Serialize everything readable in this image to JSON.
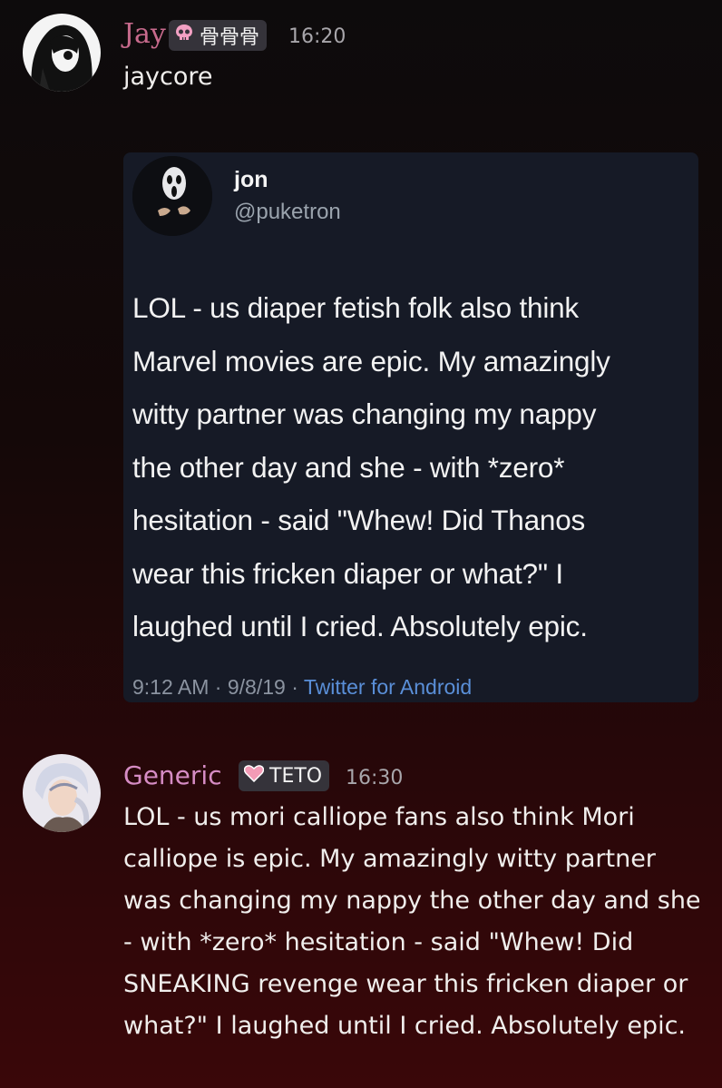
{
  "messages": [
    {
      "username": "Jay",
      "username_color": "#c76a8c",
      "tag_icon": "skull-icon",
      "tag_text": "骨骨骨",
      "time": "16:20",
      "text": "jaycore"
    },
    {
      "username": "Generic",
      "username_color": "#d68cc4",
      "tag_icon": "pink-heart-icon",
      "tag_text": "TETO",
      "time": "16:30",
      "text": "LOL - us mori calliope fans also think Mori calliope is epic. My amazingly witty partner was changing my nappy the other day and she - with *zero* hesitation - said \"Whew! Did SNEAKING revenge wear this fricken diaper or what?\" I laughed until I cried. Absolutely epic."
    }
  ],
  "tweet": {
    "name": "jon",
    "handle": "@puketron",
    "lines": [
      "LOL - us diaper fetish folk also think",
      "Marvel movies are epic. My amazingly",
      "witty partner was changing my nappy",
      "the other day and she - with *zero*",
      "hesitation - said \"Whew! Did Thanos",
      "wear this fricken diaper or what?\" I",
      "laughed until I cried. Absolutely epic."
    ],
    "time": "9:12 AM",
    "date": "9/8/19",
    "app": "Twitter for Android",
    "separator": "·"
  }
}
